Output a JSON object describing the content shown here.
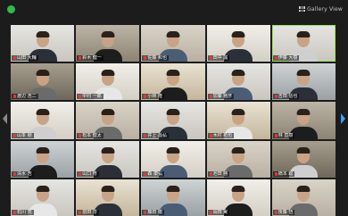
{
  "window": {
    "view_label": "Gallery View",
    "accent": "#2dbb4a",
    "active_speaker_color": "#9be55a"
  },
  "navigation": {
    "prev_icon": "chevron-left-icon",
    "next_icon": "chevron-right-icon",
    "prev_color": "#8a8a8a",
    "next_color": "#3aa0ff"
  },
  "participants": [
    {
      "name": "山田 大輔"
    },
    {
      "name": "鈴木 健一"
    },
    {
      "name": "佐藤 和也"
    },
    {
      "name": "田中 誠"
    },
    {
      "name": "伊藤 大樹"
    },
    {
      "name": "渡辺 浩二"
    },
    {
      "name": "中村 一郎"
    },
    {
      "name": "小林 隆"
    },
    {
      "name": "加藤 雅彦"
    },
    {
      "name": "吉田 信也"
    },
    {
      "name": "山本 剛"
    },
    {
      "name": "松本 健太"
    },
    {
      "name": "井上 昌弘"
    },
    {
      "name": "木村 拓也"
    },
    {
      "name": "林 直樹"
    },
    {
      "name": "清水 浩"
    },
    {
      "name": "山口 修"
    },
    {
      "name": "森 康弘"
    },
    {
      "name": "池田 勝"
    },
    {
      "name": "橋本 聡"
    },
    {
      "name": "石川 亮"
    },
    {
      "name": "前田 淳"
    },
    {
      "name": "藤田 徹"
    },
    {
      "name": "岡田 実"
    },
    {
      "name": "後藤 悟"
    }
  ]
}
